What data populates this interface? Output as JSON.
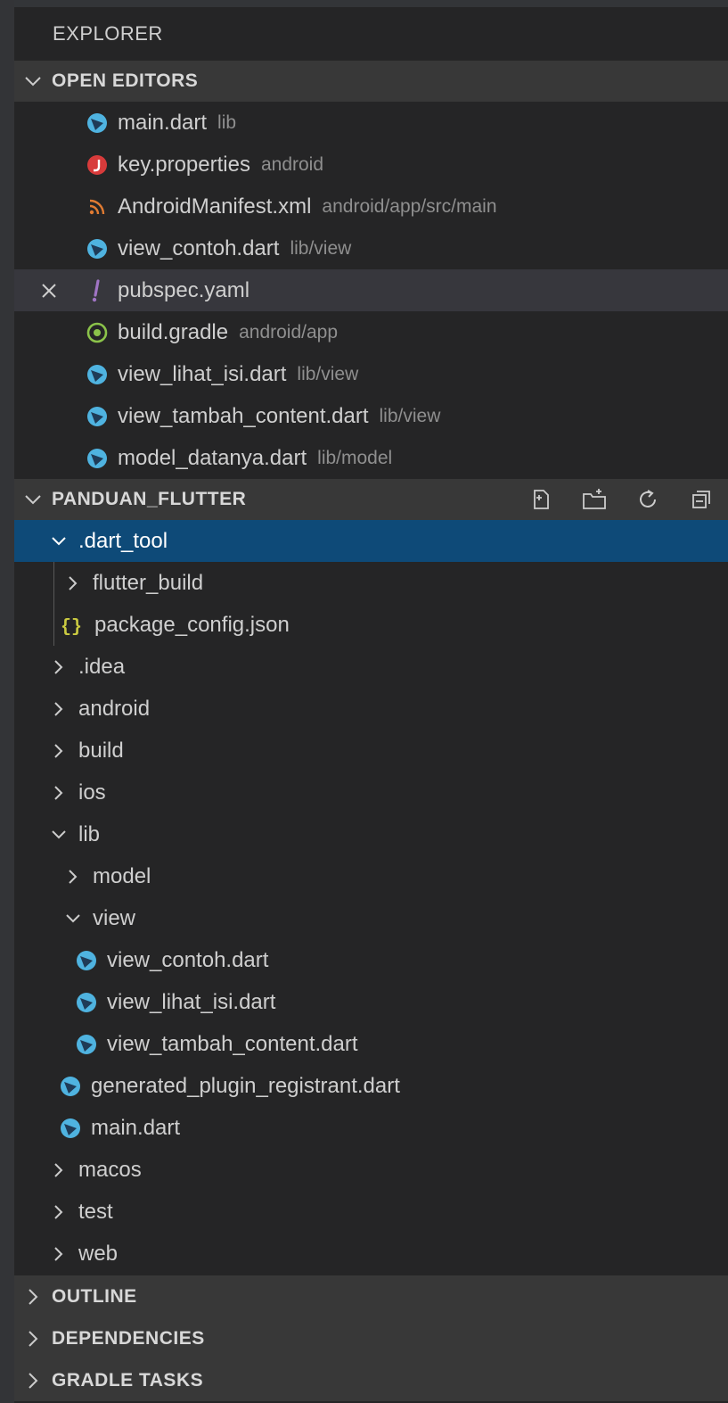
{
  "explorer": {
    "title": "EXPLORER"
  },
  "open_editors": {
    "header": "OPEN EDITORS",
    "items": [
      {
        "name": "main.dart",
        "desc": "lib",
        "icon": "dart-icon"
      },
      {
        "name": "key.properties",
        "desc": "android",
        "icon": "java-properties-icon"
      },
      {
        "name": "AndroidManifest.xml",
        "desc": "android/app/src/main",
        "icon": "rss-xml-icon"
      },
      {
        "name": "view_contoh.dart",
        "desc": "lib/view",
        "icon": "dart-icon"
      },
      {
        "name": "pubspec.yaml",
        "desc": "",
        "icon": "yaml-icon"
      },
      {
        "name": "build.gradle",
        "desc": "android/app",
        "icon": "gradle-icon"
      },
      {
        "name": "view_lihat_isi.dart",
        "desc": "lib/view",
        "icon": "dart-icon"
      },
      {
        "name": "view_tambah_content.dart",
        "desc": "lib/view",
        "icon": "dart-icon"
      },
      {
        "name": "model_datanya.dart",
        "desc": "lib/model",
        "icon": "dart-icon"
      }
    ]
  },
  "project": {
    "header": "PANDUAN_FLUTTER",
    "tree": [
      {
        "name": ".dart_tool"
      },
      {
        "name": "flutter_build"
      },
      {
        "name": "package_config.json"
      },
      {
        "name": ".idea"
      },
      {
        "name": "android"
      },
      {
        "name": "build"
      },
      {
        "name": "ios"
      },
      {
        "name": "lib"
      },
      {
        "name": "model"
      },
      {
        "name": "view"
      },
      {
        "name": "view_contoh.dart"
      },
      {
        "name": "view_lihat_isi.dart"
      },
      {
        "name": "view_tambah_content.dart"
      },
      {
        "name": "generated_plugin_registrant.dart"
      },
      {
        "name": "main.dart"
      },
      {
        "name": "macos"
      },
      {
        "name": "test"
      },
      {
        "name": "web"
      }
    ]
  },
  "sections": {
    "outline": "OUTLINE",
    "dependencies": "DEPENDENCIES",
    "gradle_tasks": "GRADLE TASKS"
  },
  "colors": {
    "selection": "#0e4a78",
    "dart": "#4fb3e0",
    "java": "#d83b3b",
    "xml": "#e07b32",
    "yaml": "#a074c4",
    "gradle": "#8bc34a",
    "json": "#cbcb41"
  }
}
